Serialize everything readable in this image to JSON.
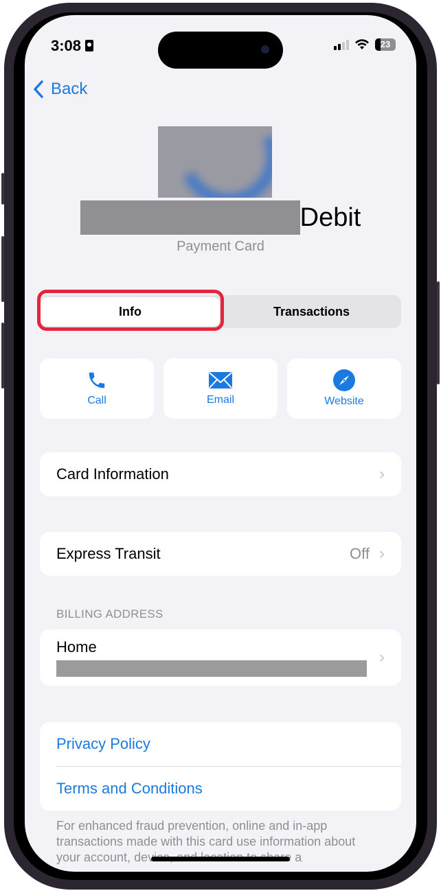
{
  "status_bar": {
    "time": "3:08",
    "focus_icon": "contact-card-icon",
    "battery": "23",
    "signal_icon": "cellular-signal-icon",
    "wifi_icon": "wifi-icon"
  },
  "nav": {
    "back_label": "Back",
    "back_icon": "chevron-left-icon"
  },
  "card": {
    "title_suffix": "Debit",
    "name_redacted": true,
    "subtitle": "Payment Card"
  },
  "segmented": {
    "tabs": [
      {
        "label": "Info",
        "active": true
      },
      {
        "label": "Transactions",
        "active": false
      }
    ]
  },
  "actions": [
    {
      "label": "Call",
      "icon": "phone-icon"
    },
    {
      "label": "Email",
      "icon": "envelope-icon"
    },
    {
      "label": "Website",
      "icon": "compass-icon"
    }
  ],
  "rows": {
    "card_information": {
      "label": "Card Information"
    },
    "express_transit": {
      "label": "Express Transit",
      "value": "Off"
    }
  },
  "billing": {
    "section_label": "BILLING ADDRESS",
    "address_label": "Home"
  },
  "links": {
    "privacy": "Privacy Policy",
    "terms": "Terms and Conditions"
  },
  "footnote": "For enhanced fraud prevention, online and in-app transactions made with this card use information about your account, device, and location to share a",
  "colors": {
    "accent": "#1a7ae0",
    "highlight": "#e6243c",
    "background": "#f2f2f7"
  }
}
